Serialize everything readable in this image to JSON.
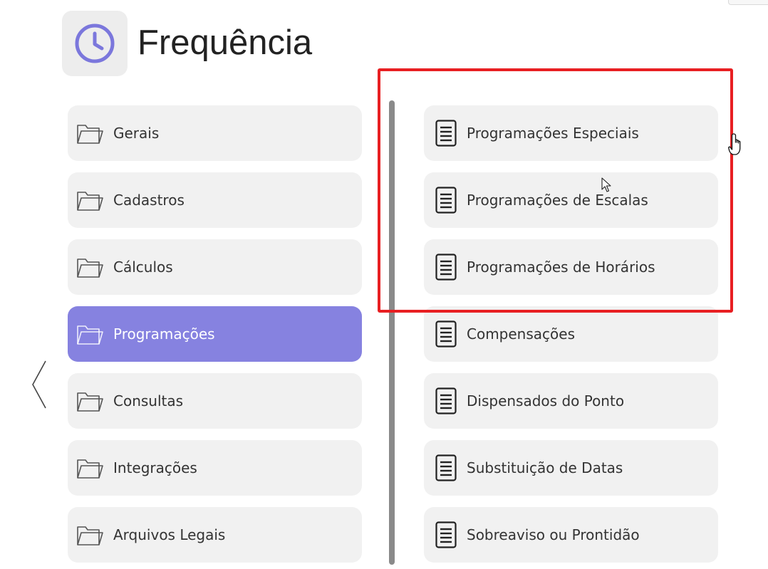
{
  "header": {
    "title": "Frequência",
    "icon": "clock-icon",
    "accent_color": "#8682e0"
  },
  "left_menu": {
    "items": [
      {
        "label": "Gerais",
        "icon": "folder-icon",
        "active": false
      },
      {
        "label": "Cadastros",
        "icon": "folder-icon",
        "active": false
      },
      {
        "label": "Cálculos",
        "icon": "folder-icon",
        "active": false
      },
      {
        "label": "Programações",
        "icon": "folder-icon",
        "active": true
      },
      {
        "label": "Consultas",
        "icon": "folder-icon",
        "active": false
      },
      {
        "label": "Integrações",
        "icon": "folder-icon",
        "active": false
      },
      {
        "label": "Arquivos Legais",
        "icon": "folder-icon",
        "active": false
      }
    ]
  },
  "right_menu": {
    "items": [
      {
        "label": "Programações Especiais",
        "icon": "document-icon"
      },
      {
        "label": "Programações de Escalas",
        "icon": "document-icon"
      },
      {
        "label": "Programações de Horários",
        "icon": "document-icon"
      },
      {
        "label": "Compensações",
        "icon": "document-icon"
      },
      {
        "label": "Dispensados do Ponto",
        "icon": "document-icon"
      },
      {
        "label": "Substituição de Datas",
        "icon": "document-icon"
      },
      {
        "label": "Sobreaviso ou Prontidão",
        "icon": "document-icon"
      }
    ]
  },
  "colors": {
    "highlight_border": "#e81f22",
    "item_background": "#f1f1f1",
    "active_background": "#8682e0"
  }
}
